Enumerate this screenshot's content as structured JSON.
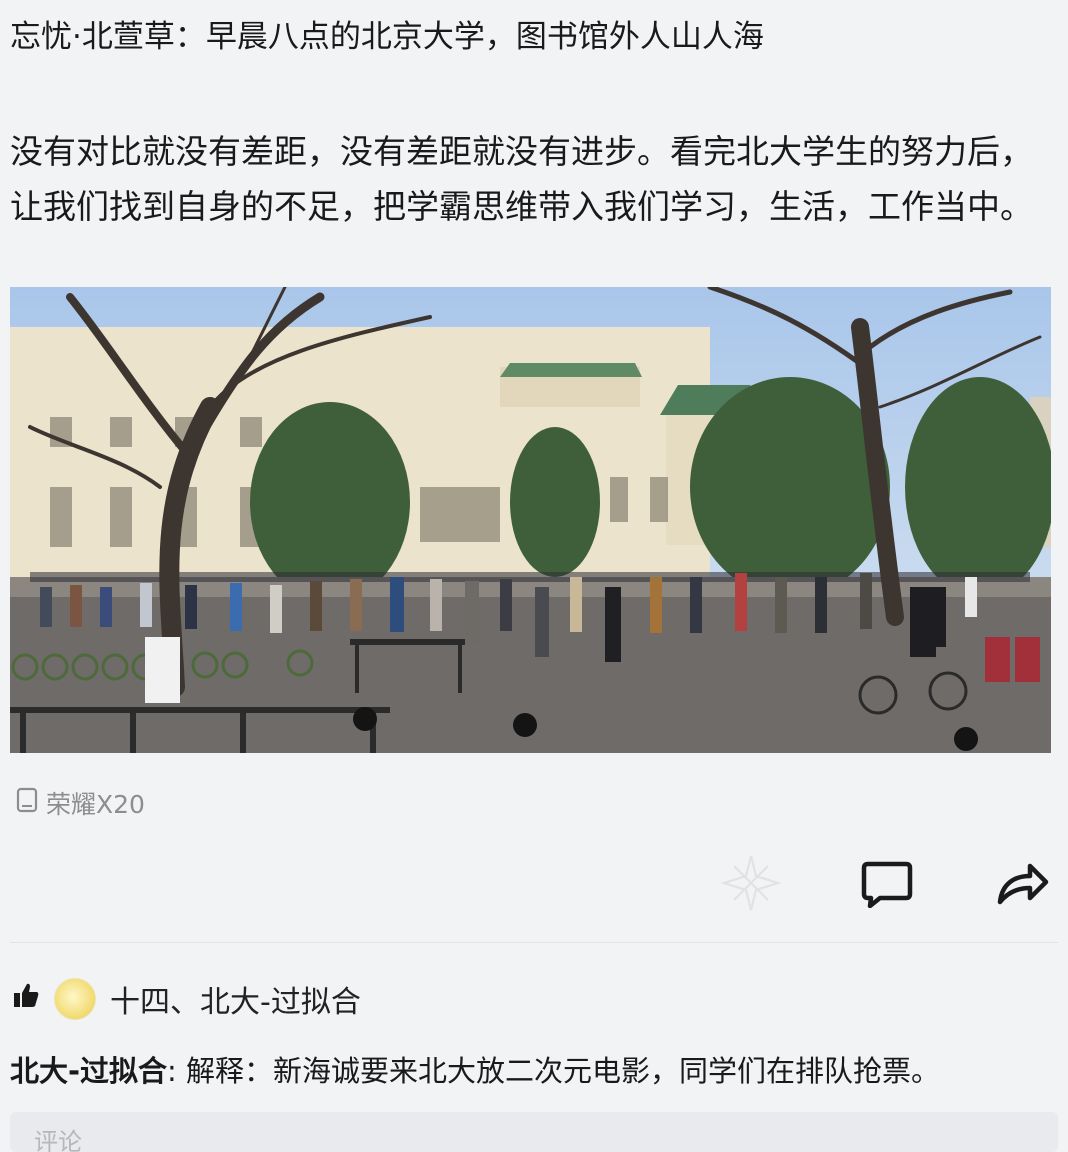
{
  "post": {
    "title": "忘忧·北萱草：早晨八点的北京大学，图书馆外人山人海",
    "body": "没有对比就没有差距，没有差距就没有进步。看完北大学生的努力后，让我们找到自身的不足，把学霸思维带入我们学习，生活，工作当中。",
    "device": "荣耀X20"
  },
  "actions": {
    "icons": [
      "sparkle-icon",
      "comment-icon",
      "share-icon"
    ]
  },
  "likes": {
    "text": "十四、北大-过拟合"
  },
  "comment": {
    "author": "北大-过拟合",
    "text": "解释：新海诚要来北大放二次元电影，同学们在排队抢票。"
  },
  "comment_input": {
    "placeholder": "评论"
  }
}
